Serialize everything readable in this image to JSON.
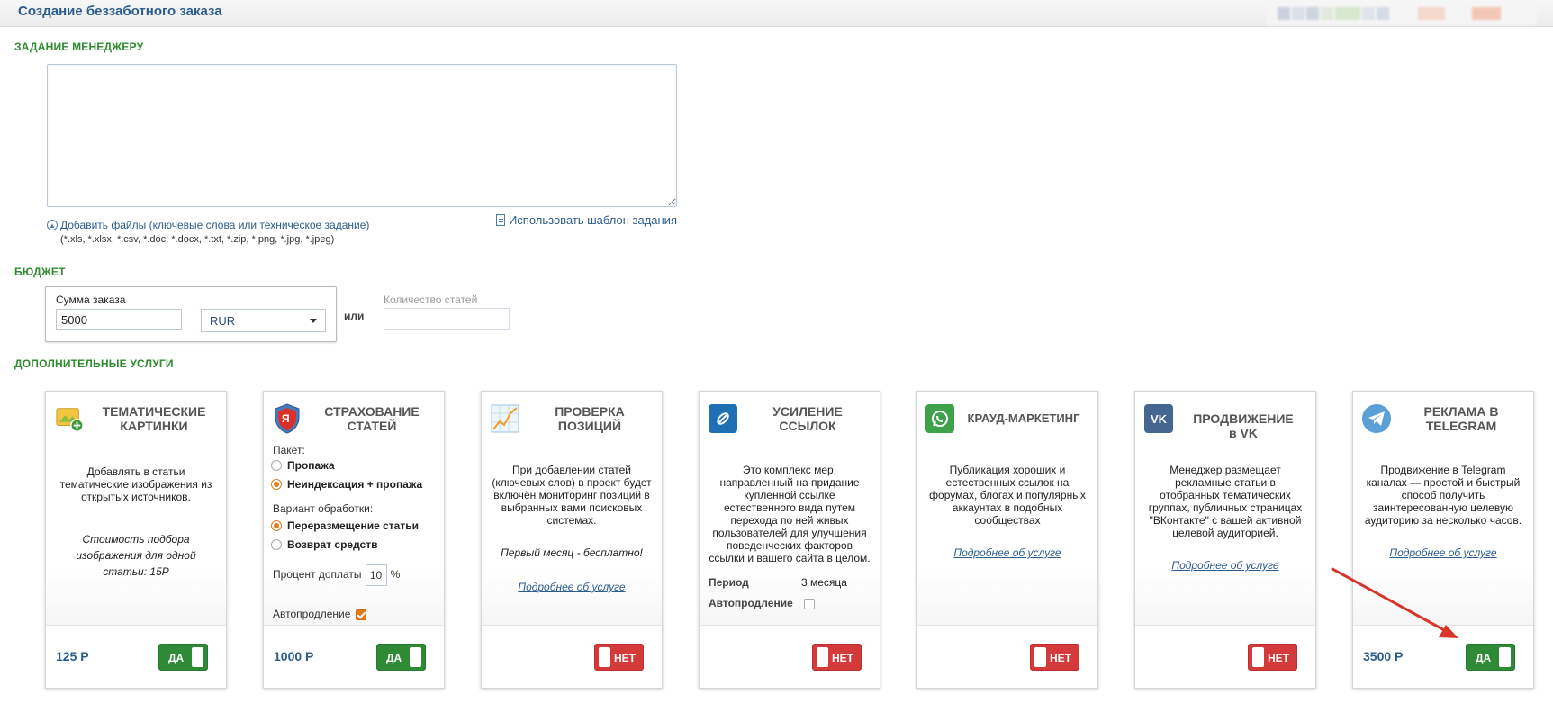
{
  "header": {
    "title": "Создание беззаботного заказа"
  },
  "manager_task": {
    "section_title": "ЗАДАНИЕ МЕНЕДЖЕРУ",
    "text": "",
    "attach_link": "Добавить файлы (ключевые слова или техническое задание)",
    "formats": "(*.xls, *.xlsx, *.csv, *.doc, *.docx, *.txt, *.zip, *.png, *.jpg, *.jpeg)",
    "template_link": "Использовать шаблон задания"
  },
  "budget": {
    "section_title": "БЮДЖЕТ",
    "amount_label": "Сумма заказа",
    "amount_value": "5000",
    "currency": "RUR",
    "or_label": "или",
    "count_label": "Количество статей",
    "count_value": ""
  },
  "services": {
    "section_title": "ДОПОЛНИТЕЛЬНЫЕ УСЛУГИ",
    "cards": [
      {
        "title_line1": "Тематические",
        "title_line2": "картинки",
        "description": "Добавлять в статьи тематические изображения из открытых источников.",
        "note": "Стоимость подбора изображения для одной статьи: 15Р",
        "price": "125 Р",
        "toggle": "ДА",
        "enabled": true,
        "icon": "image-plus-icon"
      },
      {
        "title_line1": "Страхование",
        "title_line2": "статей",
        "package_label": "Пакет:",
        "package_options": [
          "Пропажа",
          "Неиндексация + пропажа"
        ],
        "package_selected": 1,
        "processing_label": "Вариант обработки:",
        "processing_options": [
          "Переразмещение статьи",
          "Возврат средств"
        ],
        "processing_selected": 0,
        "percent_label": "Процент доплаты",
        "percent_value": "10",
        "percent_unit": "%",
        "autorenew_label": "Автопродление",
        "autorenew": true,
        "price": "1000 Р",
        "toggle": "ДА",
        "enabled": true,
        "icon": "yandex-shield-icon",
        "icon_letter": "Я"
      },
      {
        "title_line1": "Проверка",
        "title_line2": "позиций",
        "description": "При добавлении статей (ключевых слов) в проект будет включён мониторинг позиций в выбранных вами поисковых системах.",
        "note": "Первый месяц - бесплатно!",
        "more_link": "Подробнее об услуге",
        "toggle": "НЕТ",
        "enabled": false,
        "icon": "chart-icon"
      },
      {
        "title_line1": "Усиление",
        "title_line2": "ссылок",
        "description": "Это комплекс мер, направленный на придание купленной ссылке естественного вида путем перехода по ней живых пользователей для улучшения поведенческих факторов ссылки и вашего сайта в целом.",
        "period_label": "Период",
        "period_value": "3 месяца",
        "autorenew_label": "Автопродление",
        "autorenew": false,
        "toggle": "НЕТ",
        "enabled": false,
        "icon": "link-icon"
      },
      {
        "title_line1": "Крауд-маркетинг",
        "title_line2": "",
        "description": "Публикация хороших и естественных ссылок на форумах, блогах и популярных аккаунтах в подобных сообществах",
        "more_link": "Подробнее об услуге",
        "toggle": "НЕТ",
        "enabled": false,
        "icon": "whatsapp-icon"
      },
      {
        "title_line1": "Продвижение",
        "title_line2": "в VK",
        "description": "Менеджер размещает рекламные статьи в отобранных тематических группах, публичных страницах \"ВКонтакте\" с вашей активной целевой аудиторией.",
        "more_link": "Подробнее об услуге",
        "toggle": "НЕТ",
        "enabled": false,
        "icon": "vk-icon",
        "icon_letter": "VK"
      },
      {
        "title_line1": "Реклама в",
        "title_line2": "Telegram",
        "description": "Продвижение в Telegram каналах — простой и быстрый способ получить заинтересованную целевую аудиторию за несколько часов.",
        "more_link": "Подробнее об услуге",
        "price": "3500 Р",
        "toggle": "ДА",
        "enabled": true,
        "icon": "telegram-icon"
      }
    ]
  },
  "colors": {
    "accent_green": "#2e8b2e",
    "link_blue": "#2b5d8c",
    "toggle_yes": "#2f8a36",
    "toggle_no": "#d43a3a",
    "arrow": "#d9362b"
  }
}
